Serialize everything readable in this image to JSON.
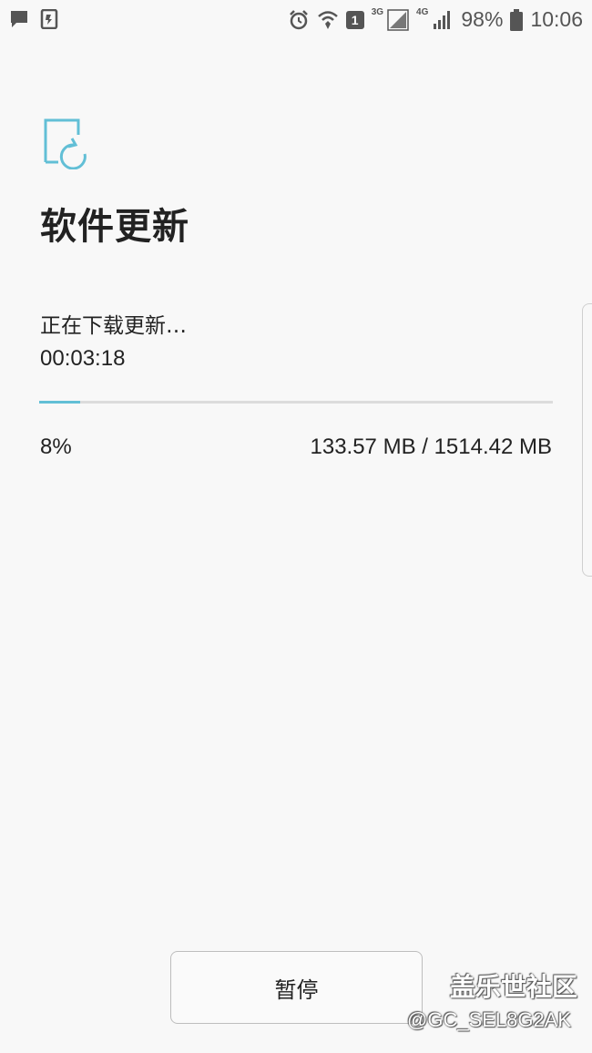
{
  "status_bar": {
    "left_icons": [
      "message-icon",
      "phone-transfer-icon"
    ],
    "right_icons": [
      "alarm-icon",
      "wifi-calling-icon",
      "sim-icon",
      "signal-3g-icon",
      "signal-4g-icon",
      "battery-icon"
    ],
    "sim_badge": "1",
    "net_3g_label": "3G",
    "net_4g_label": "4G",
    "battery_percent": "98%",
    "time": "10:06"
  },
  "page": {
    "icon": "software-update-icon",
    "title": "软件更新"
  },
  "download": {
    "status": "正在下载更新…",
    "elapsed": "00:03:18",
    "progress_fraction": 0.08,
    "percent_text": "8%",
    "size_text": "133.57 MB / 1514.42 MB"
  },
  "actions": {
    "pause_label": "暂停"
  },
  "watermark": {
    "title": "盖乐世社区",
    "handle": "@GC_SEL8G2AK"
  },
  "colors": {
    "accent": "#62bfd6",
    "background": "#f8f8f8",
    "text": "#222222"
  }
}
